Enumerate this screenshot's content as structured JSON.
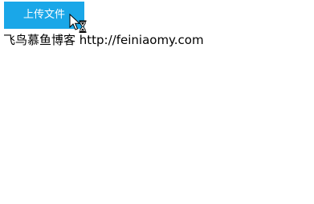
{
  "upload_button": {
    "label": "上传文件",
    "color": "#1aa7e8"
  },
  "blog_text": "飞鸟慕鱼博客 http://feiniaomy.com",
  "cursor": {
    "icon": "arrow-busy-hourglass-icon"
  }
}
